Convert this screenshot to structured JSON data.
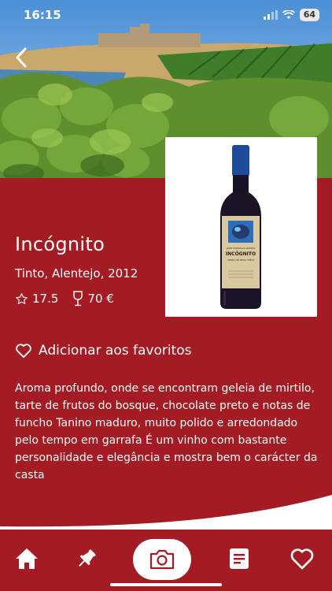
{
  "status": {
    "time": "16:15",
    "battery": "64"
  },
  "wine": {
    "name": "Incógnito",
    "subtitle": "Tinto, Alentejo, 2012",
    "rating": "17.5",
    "price": "70 €",
    "label_brand": "INCÓGNITO",
    "label_top": "JOÃO PORTUGAL RAMOS",
    "label_sub": "VINHO DE MESA TINTO"
  },
  "favorite": {
    "label": "Adicionar aos favoritos"
  },
  "description": "Aroma profundo, onde se encontram geleia de mirtilo, tarte de frutos do bosque, chocolate preto e notas de funcho  Tanino maduro, muito polido e arredondado pelo tempo em garrafa  É um vinho com bastante personalidade e elegância e mostra bem o carácter da casta",
  "nav": {
    "items": [
      "home-icon",
      "pin-icon",
      "camera-icon",
      "document-icon",
      "heart-icon"
    ]
  },
  "colors": {
    "brand": "#a51b24",
    "white": "#ffffff"
  }
}
